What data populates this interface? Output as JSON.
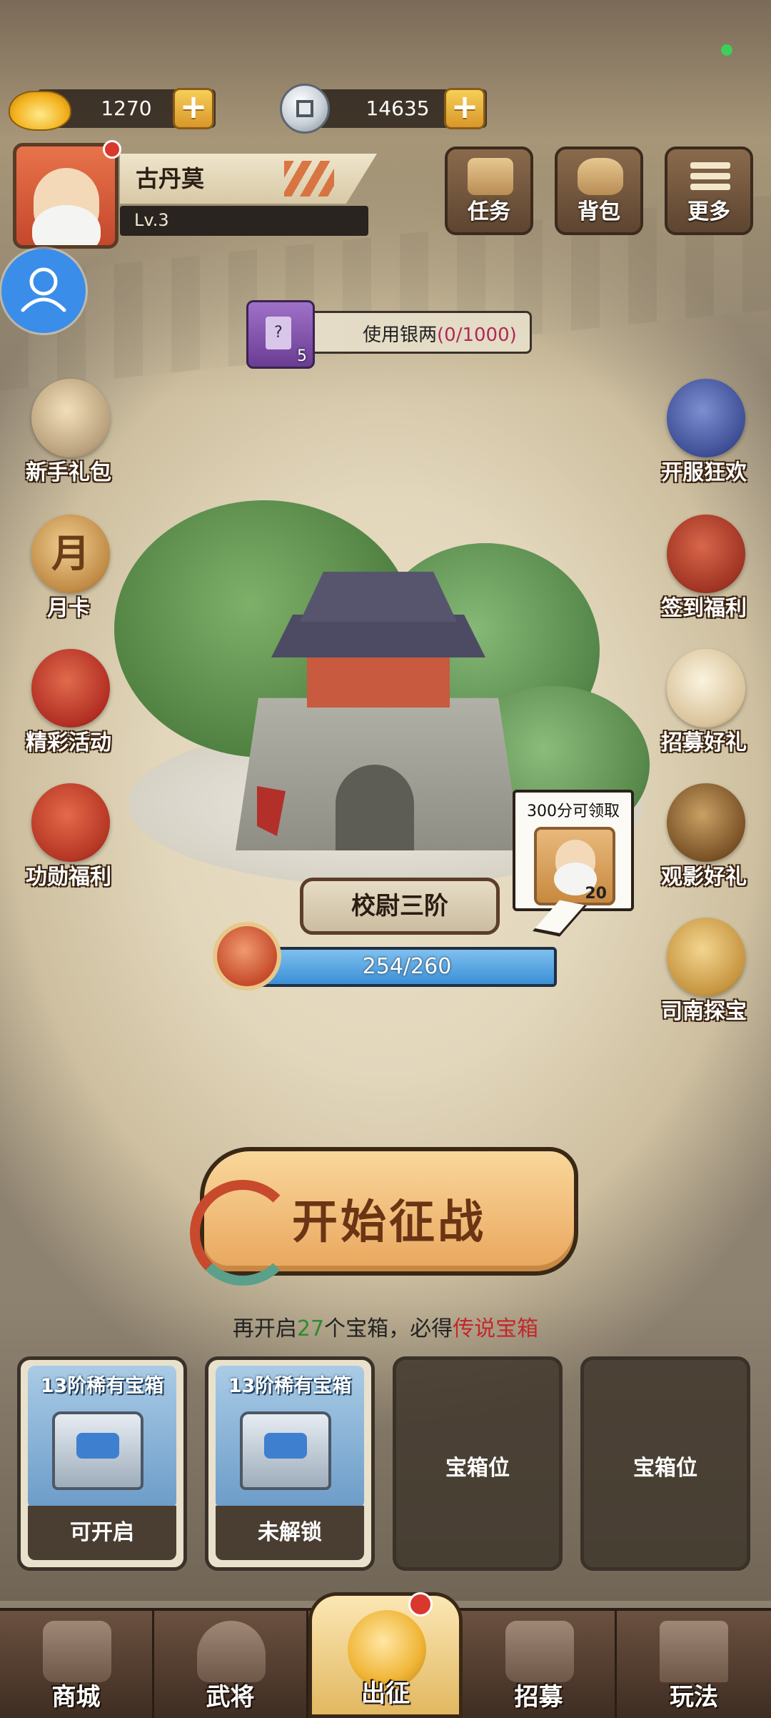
{
  "currencies": {
    "gold_ingot": "1270",
    "silver_coin": "14635",
    "plus": "+"
  },
  "player": {
    "name": "古丹莫",
    "level": "Lv.3"
  },
  "top_buttons": {
    "tasks": "任务",
    "bag": "背包",
    "more": "更多"
  },
  "card_banner": {
    "text": "使用银两",
    "progress": "(0/1000)",
    "card_count": "5",
    "card_mark": "?"
  },
  "left_menu": [
    "新手礼包",
    "月卡",
    "精彩活动",
    "功勋福利"
  ],
  "right_menu": [
    "开服狂欢",
    "签到福利",
    "招募好礼",
    "观影好礼",
    "司南探宝"
  ],
  "month_card_char": "月",
  "rank": {
    "title": "校尉三阶",
    "exp": "254/260",
    "progress": 0.977
  },
  "reward": {
    "text": "300分可领取",
    "count": "20"
  },
  "battle_button": "开始征战",
  "hint": {
    "prefix": "再开启",
    "count": "27",
    "middle": "个宝箱，必得",
    "highlight": "传说宝箱"
  },
  "chest_slots": [
    {
      "title": "13阶稀有宝箱",
      "status": "可开启"
    },
    {
      "title": "13阶稀有宝箱",
      "status": "未解锁"
    },
    {
      "label": "宝箱位"
    },
    {
      "label": "宝箱位"
    }
  ],
  "nav": [
    "商城",
    "武将",
    "出征",
    "招募",
    "玩法"
  ],
  "colors": {
    "accent_gold": "#f0b536",
    "exp_bar": "#3b8fd6",
    "badge_red": "#d9382e",
    "highlight_green": "#2e8b30",
    "highlight_red": "#c2282a"
  }
}
